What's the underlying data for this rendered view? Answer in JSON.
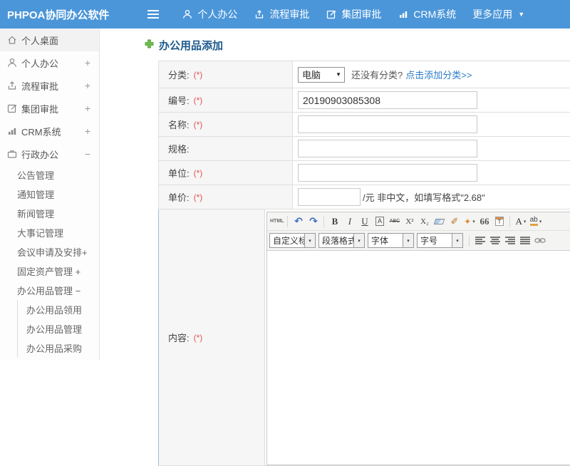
{
  "colors": {
    "topbar": "#4b96d9",
    "title": "#1d5a8c",
    "link": "#2b7bc6",
    "required": "#e25353",
    "content_row_highlight": "#9cc1da"
  },
  "topbar": {
    "brand": "PHPOA协同办公软件",
    "menu": [
      {
        "label": "个人办公",
        "icon": "user-icon"
      },
      {
        "label": "流程审批",
        "icon": "process-icon"
      },
      {
        "label": "集团审批",
        "icon": "edit-square-icon"
      },
      {
        "label": "CRM系统",
        "icon": "bar-chart-icon"
      },
      {
        "label": "更多应用",
        "icon": "caret-down-icon"
      }
    ]
  },
  "sidebar": {
    "items": [
      {
        "label": "个人桌面",
        "icon": "home-icon"
      },
      {
        "label": "个人办公",
        "icon": "user-icon",
        "expander": "+"
      },
      {
        "label": "流程审批",
        "icon": "process-icon",
        "expander": "+"
      },
      {
        "label": "集团审批",
        "icon": "edit-square-icon",
        "expander": "+"
      },
      {
        "label": "CRM系统",
        "icon": "bar-chart-icon",
        "expander": "+"
      },
      {
        "label": "行政办公",
        "icon": "briefcase-icon",
        "expander": "−"
      }
    ],
    "submenu": [
      {
        "label": "公告管理"
      },
      {
        "label": "通知管理"
      },
      {
        "label": "新闻管理"
      },
      {
        "label": "大事记管理"
      },
      {
        "label": "会议申请及安排+"
      },
      {
        "label": "固定资产管理 +"
      },
      {
        "label": "办公用品管理 −"
      }
    ],
    "subsubmenu": [
      {
        "label": "办公用品领用"
      },
      {
        "label": "办公用品管理"
      },
      {
        "label": "办公用品采购"
      }
    ]
  },
  "page": {
    "title": "办公用品添加",
    "title_icon": "green-plus-icon"
  },
  "form": {
    "required_mark": "(*)",
    "category": {
      "label": "分类:",
      "selected": "电脑",
      "hint": "还没有分类?",
      "link": "点击添加分类>>"
    },
    "code": {
      "label": "编号:",
      "value": "20190903085308"
    },
    "name": {
      "label": "名称:"
    },
    "spec": {
      "label": "规格:"
    },
    "unit": {
      "label": "单位:"
    },
    "price": {
      "label": "单价:",
      "suffix": "/元 非中文，如填写格式\"2.68\""
    },
    "content": {
      "label": "内容:"
    }
  },
  "editor": {
    "source_label": "HTML",
    "bold": "B",
    "italic": "I",
    "underline": "U",
    "char_border": "A",
    "strike": "ABC",
    "superscript": "X²",
    "subscript": "X₂",
    "quote": "66",
    "font_color": "A",
    "back_color": "ab",
    "heading_select": "自定义标题",
    "paragraph_select": "段落格式",
    "font_select": "字体",
    "size_select": "字号"
  },
  "icons": {
    "caret_down": "▼",
    "combo_caret": "▾",
    "undo": "↶",
    "redo": "↷",
    "brush": "✐",
    "magic": "✦"
  }
}
